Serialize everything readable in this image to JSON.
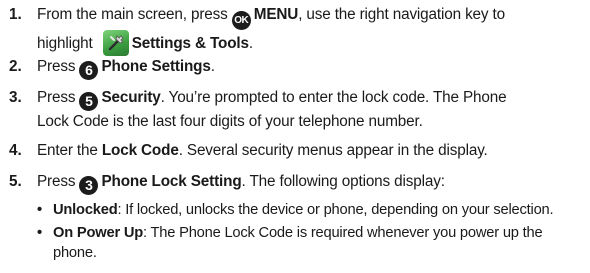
{
  "steps": [
    {
      "num": "1.",
      "part1": "From the main screen, press ",
      "key_label": "OK",
      "bold1": "MENU",
      "part2": ", use the right navigation key to",
      "line2_pre": "highlight ",
      "bold2": "Settings & Tools",
      "part3": "."
    },
    {
      "num": "2.",
      "pre": "Press ",
      "key_label": "6",
      "bold": "Phone Settings",
      "post": "."
    },
    {
      "num": "3.",
      "pre": "Press ",
      "key_label": "5",
      "bold": "Security",
      "post": ". You’re prompted to enter the lock code. The Phone",
      "line2": "Lock Code is the last four digits of your telephone number."
    },
    {
      "num": "4.",
      "pre": "Enter the ",
      "bold": "Lock Code",
      "post": ". Several security menus appear in the display."
    },
    {
      "num": "5.",
      "pre": "Press ",
      "key_label": "3",
      "bold": "Phone Lock Setting",
      "post": ". The following options display:"
    }
  ],
  "bullets": [
    {
      "dot": "•",
      "bold": "Unlocked",
      "text": ": If locked, unlocks the device or phone, depending on your selection."
    },
    {
      "dot": "•",
      "bold": "On Power Up",
      "text": ": The Phone Lock Code is required whenever you power up the",
      "line2": "phone."
    }
  ],
  "icons": {
    "ok_key": "ok-key-icon",
    "settings_tools": "settings-tools-icon",
    "key6": "number-6-key-icon",
    "key5": "number-5-key-icon",
    "key3": "number-3-key-icon"
  },
  "colors": {
    "text": "#1a1a1a",
    "key_background": "#1c1c1c",
    "icon_green": "#3a9c3f"
  }
}
